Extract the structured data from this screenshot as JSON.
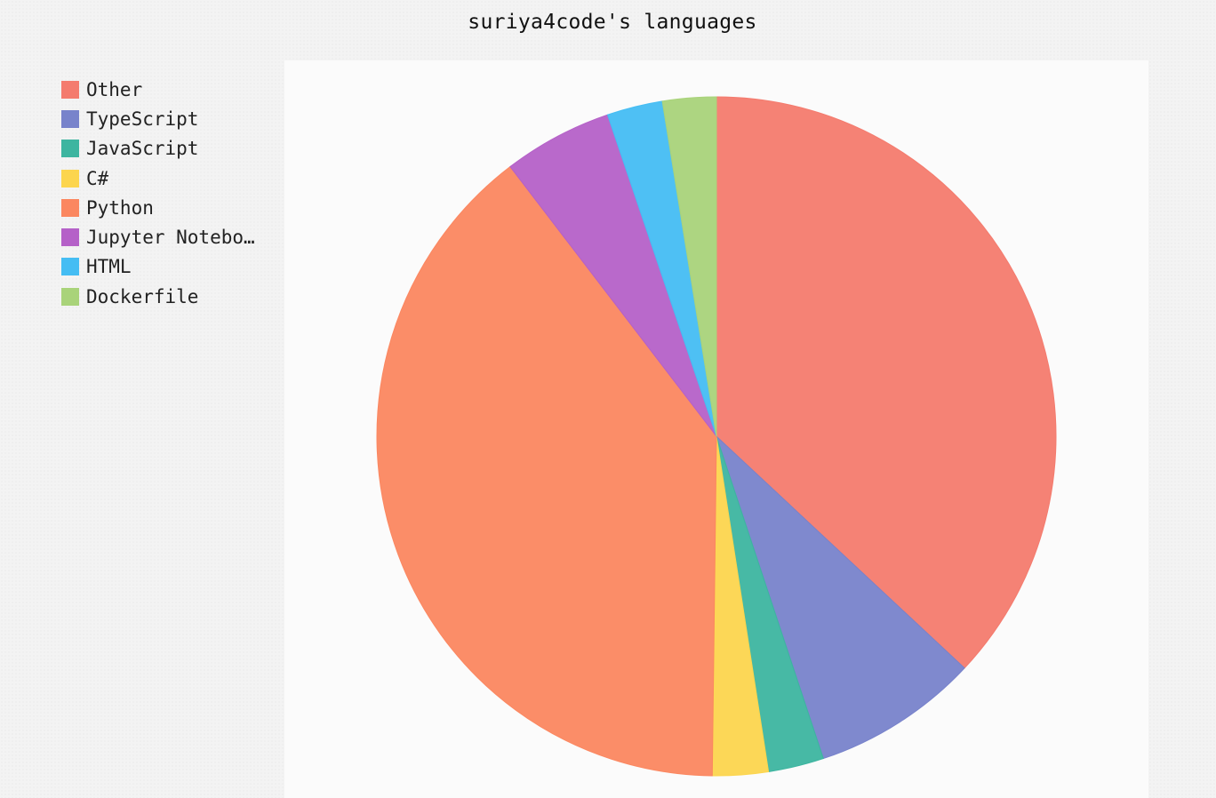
{
  "chart_data": {
    "type": "pie",
    "title": "suriya4code's languages",
    "legend_position": "left",
    "slices": [
      {
        "label": "Other",
        "value": 37.7,
        "color": "#f47b6e"
      },
      {
        "label": "TypeScript",
        "value": 8.1,
        "color": "#7883cb"
      },
      {
        "label": "JavaScript",
        "value": 2.7,
        "color": "#3db5a0"
      },
      {
        "label": "C#",
        "value": 2.7,
        "color": "#fcd54e"
      },
      {
        "label": "Python",
        "value": 40.2,
        "color": "#fb8760"
      },
      {
        "label": "Jupyter Notebook",
        "value": 5.3,
        "color": "#b561c8"
      },
      {
        "label": "HTML",
        "value": 2.7,
        "color": "#45bdf3"
      },
      {
        "label": "Dockerfile",
        "value": 2.6,
        "color": "#a9d37a"
      }
    ]
  }
}
